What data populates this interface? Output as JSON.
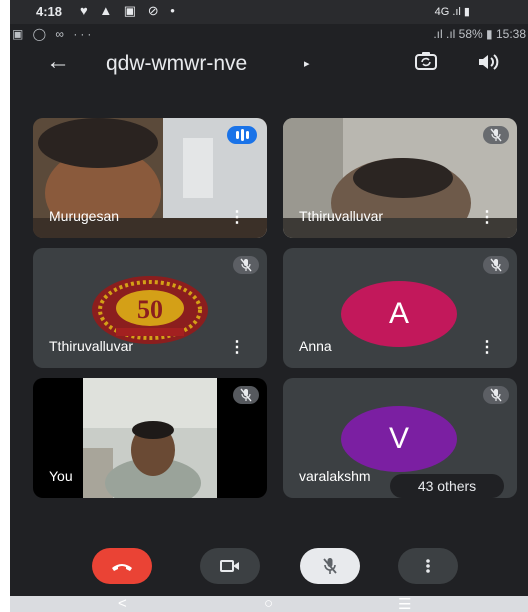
{
  "outer_status": {
    "time": "4:18",
    "icons": "♥ ▲ ▣ ⊘ •",
    "right": "4G .ıl ▮"
  },
  "inner_status": {
    "left": "▣ ◯ ∞ ···",
    "right": ".ıl .ıl 58% ▮ 15:38"
  },
  "meeting": {
    "back_glyph": "←",
    "code": "qdw-wmwr-nve",
    "caret": "▸"
  },
  "tiles": [
    {
      "name": "Murugesan",
      "more": "⋮"
    },
    {
      "name": "Tthiruvalluvar",
      "more": "⋮"
    },
    {
      "name": "Tthiruvalluvar",
      "more": "⋮"
    },
    {
      "name": "Anna",
      "more": "⋮",
      "avatar_letter": "A",
      "avatar_color": "#c2185b"
    },
    {
      "name": "You"
    },
    {
      "name": "varalakshm",
      "avatar_letter": "V",
      "avatar_color": "#7b1fa2"
    }
  ],
  "others_badge": "43 others",
  "nav": {
    "back": "<",
    "home": "○",
    "recents": "☰"
  },
  "colors": {
    "background": "#202124",
    "tile": "#3c4043",
    "end_call": "#ea4335",
    "speaking": "#1a73e8"
  }
}
